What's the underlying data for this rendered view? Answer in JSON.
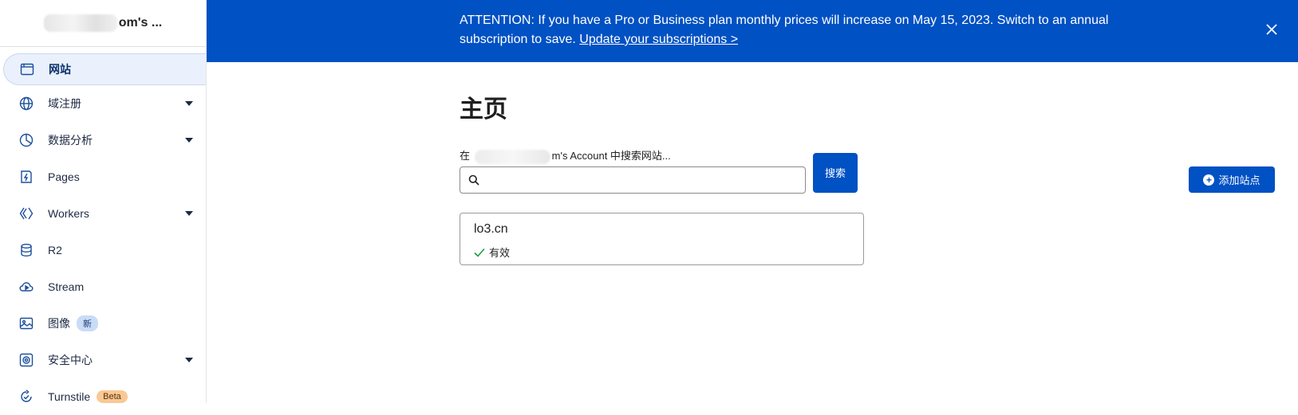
{
  "sidebar": {
    "account_name": "om's ...",
    "items": [
      {
        "label": "网站",
        "icon": "browser-window-icon",
        "active": true,
        "caret": false
      },
      {
        "label": "域注册",
        "icon": "globe-icon",
        "active": false,
        "caret": true
      },
      {
        "label": "数据分析",
        "icon": "pie-chart-icon",
        "active": false,
        "caret": true
      },
      {
        "label": "Pages",
        "icon": "lightning-icon",
        "active": false,
        "caret": false
      },
      {
        "label": "Workers",
        "icon": "workers-icon",
        "active": false,
        "caret": true
      },
      {
        "label": "R2",
        "icon": "database-icon",
        "active": false,
        "caret": false
      },
      {
        "label": "Stream",
        "icon": "cloud-play-icon",
        "active": false,
        "caret": false
      },
      {
        "label": "图像",
        "icon": "image-icon",
        "active": false,
        "caret": false,
        "badge": "新"
      },
      {
        "label": "安全中心",
        "icon": "security-icon",
        "active": false,
        "caret": true
      },
      {
        "label": "Turnstile",
        "icon": "turnstile-icon",
        "active": false,
        "caret": false,
        "badge": "Beta"
      }
    ]
  },
  "banner": {
    "text": "ATTENTION: If you have a Pro or Business plan monthly prices will increase on May 15, 2023. Switch to an annual subscription to save. ",
    "link": "Update your subscriptions >",
    "close_icon": "close-icon"
  },
  "main": {
    "title": "主页",
    "search_hint_prefix": "在",
    "search_hint_suffix": "m's Account 中搜索网站...",
    "search_value": "",
    "search_button": "搜索",
    "add_site_button": "添加站点",
    "sites": [
      {
        "name": "lo3.cn",
        "status": "有效"
      }
    ]
  },
  "colors": {
    "brand_blue": "#0051c3",
    "active_bg": "#eaf1fc",
    "status_green": "#1a9e3f",
    "badge_new_bg": "#c9dcf7",
    "badge_beta_bg": "#f9c894"
  }
}
